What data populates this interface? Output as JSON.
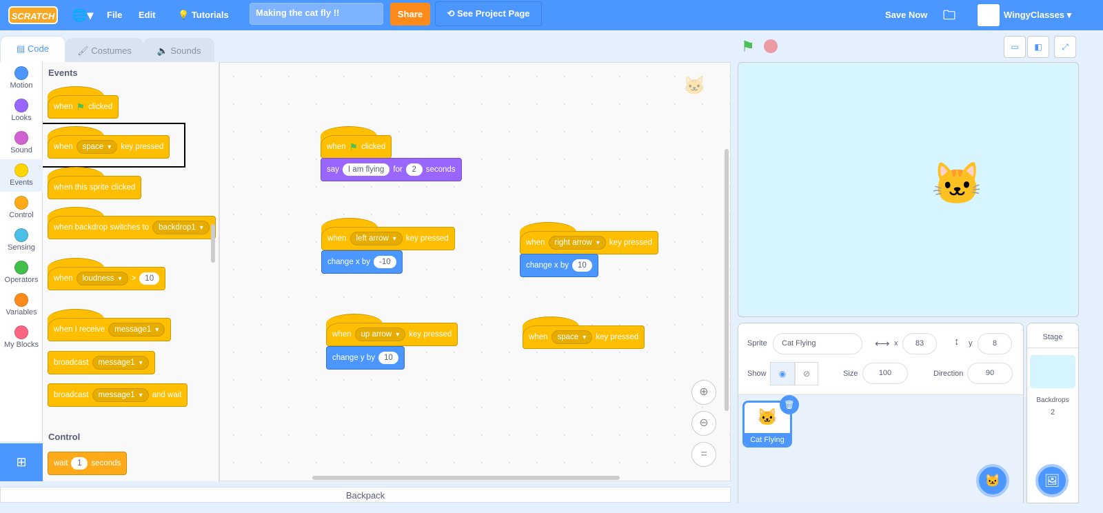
{
  "menu": {
    "logo": "SCRATCH",
    "file": "File",
    "edit": "Edit",
    "tutorials": "Tutorials",
    "project_title": "Making the cat fly !!",
    "share": "Share",
    "see_project_page": "See Project Page",
    "save_now": "Save Now",
    "user": "WingyClasses"
  },
  "tabs": [
    {
      "label": "Code"
    },
    {
      "label": "Costumes"
    },
    {
      "label": "Sounds"
    }
  ],
  "categories": [
    {
      "label": "Motion",
      "color": "#4C97FF"
    },
    {
      "label": "Looks",
      "color": "#9966FF"
    },
    {
      "label": "Sound",
      "color": "#CF63CF"
    },
    {
      "label": "Events",
      "color": "#FFD500"
    },
    {
      "label": "Control",
      "color": "#FFAB19"
    },
    {
      "label": "Sensing",
      "color": "#4CBFE6"
    },
    {
      "label": "Operators",
      "color": "#40BF4A"
    },
    {
      "label": "Variables",
      "color": "#FF8C1A"
    },
    {
      "label": "My Blocks",
      "color": "#FF6680"
    }
  ],
  "palette": {
    "events_heading": "Events",
    "control_heading": "Control",
    "b1": {
      "when": "when",
      "clicked": "clicked"
    },
    "b2": {
      "when": "when",
      "key": "space",
      "pressed": "key pressed"
    },
    "b3": {
      "text": "when this sprite clicked"
    },
    "b4": {
      "text": "when backdrop switches to",
      "value": "backdrop1"
    },
    "b5": {
      "when": "when",
      "menu": "loudness",
      "op": ">",
      "value": "10"
    },
    "b6": {
      "text": "when I receive",
      "value": "message1"
    },
    "b7": {
      "text": "broadcast",
      "value": "message1"
    },
    "b8": {
      "text": "broadcast",
      "value": "message1",
      "tail": "and wait"
    },
    "b9": {
      "wait": "wait",
      "value": "1",
      "seconds": "seconds"
    }
  },
  "scripts": {
    "s1": {
      "when": "when",
      "clicked": "clicked",
      "say": "say",
      "msg": "I am flying",
      "for": "for",
      "secs": "2",
      "seconds": "seconds"
    },
    "s2": {
      "when": "when",
      "key": "left arrow",
      "pressed": "key pressed",
      "change": "change x by",
      "value": "-10"
    },
    "s3": {
      "when": "when",
      "key": "right arrow",
      "pressed": "key pressed",
      "change": "change x by",
      "value": "10"
    },
    "s4": {
      "when": "when",
      "key": "up arrow",
      "pressed": "key pressed",
      "change": "change y by",
      "value": "10"
    },
    "s5": {
      "when": "when",
      "key": "space",
      "pressed": "key pressed"
    }
  },
  "backpack": "Backpack",
  "sprite_info": {
    "sprite_label": "Sprite",
    "sprite_name": "Cat Flying",
    "x_label": "x",
    "x": "83",
    "y_label": "y",
    "y": "8",
    "show_label": "Show",
    "size_label": "Size",
    "size": "100",
    "direction_label": "Direction",
    "direction": "90"
  },
  "sprites": [
    {
      "name": "Cat Flying",
      "selected": true
    }
  ],
  "stage_pane": {
    "title": "Stage",
    "backdrops_label": "Backdrops",
    "backdrops": "2"
  }
}
